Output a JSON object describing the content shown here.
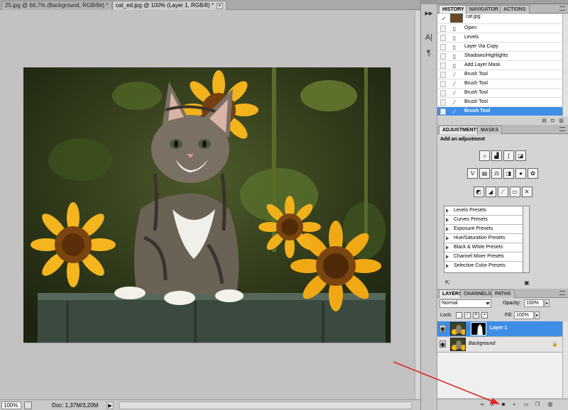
{
  "doc_tabs": [
    {
      "label": "25.jpg @ 66,7% (Background, RGB/8#) *",
      "close": "×"
    },
    {
      "label": "cat_ed.jpg @ 100% (Layer 1, RGB/8) *",
      "close": "×"
    }
  ],
  "status": {
    "zoom": "100%",
    "doc_info": "Doc: 1,37M/3,20M",
    "arrow": "▶"
  },
  "side_strip": {
    "btn1": "▸▸",
    "btn2": "A|",
    "btn3": "¶"
  },
  "history": {
    "tabs": [
      "HISTORY",
      "NAVIGATOR",
      "ACTIONS"
    ],
    "snapshot_label": "cat.jpg",
    "items": [
      "Open",
      "Levels",
      "Layer Via Copy",
      "Shadows/Highlights",
      "Add Layer Mask",
      "Brush Tool",
      "Brush Tool",
      "Brush Tool",
      "Brush Tool",
      "Brush Tool"
    ]
  },
  "adjustments": {
    "tabs": [
      "ADJUSTMENTS",
      "MASKS"
    ],
    "title": "Add an adjustment",
    "presets": [
      "Levels Presets",
      "Curves Presets",
      "Exposure Presets",
      "Hue/Saturation Presets",
      "Black & White Presets",
      "Channel Mixer Presets",
      "Selective Color Presets"
    ]
  },
  "layers": {
    "tabs": [
      "LAYERS",
      "CHANNELS",
      "PATHS"
    ],
    "blend_mode": "Normal",
    "opacity_label": "Opacity:",
    "opacity": "100%",
    "lock_label": "Lock:",
    "fill_label": "Fill:",
    "fill": "100%",
    "items": [
      {
        "name": "Layer 1",
        "selected": true
      },
      {
        "name": "Background",
        "selected": false
      }
    ]
  },
  "colors": {
    "selection": "#3e8ee6",
    "annotation_arrow": "#e32222"
  }
}
